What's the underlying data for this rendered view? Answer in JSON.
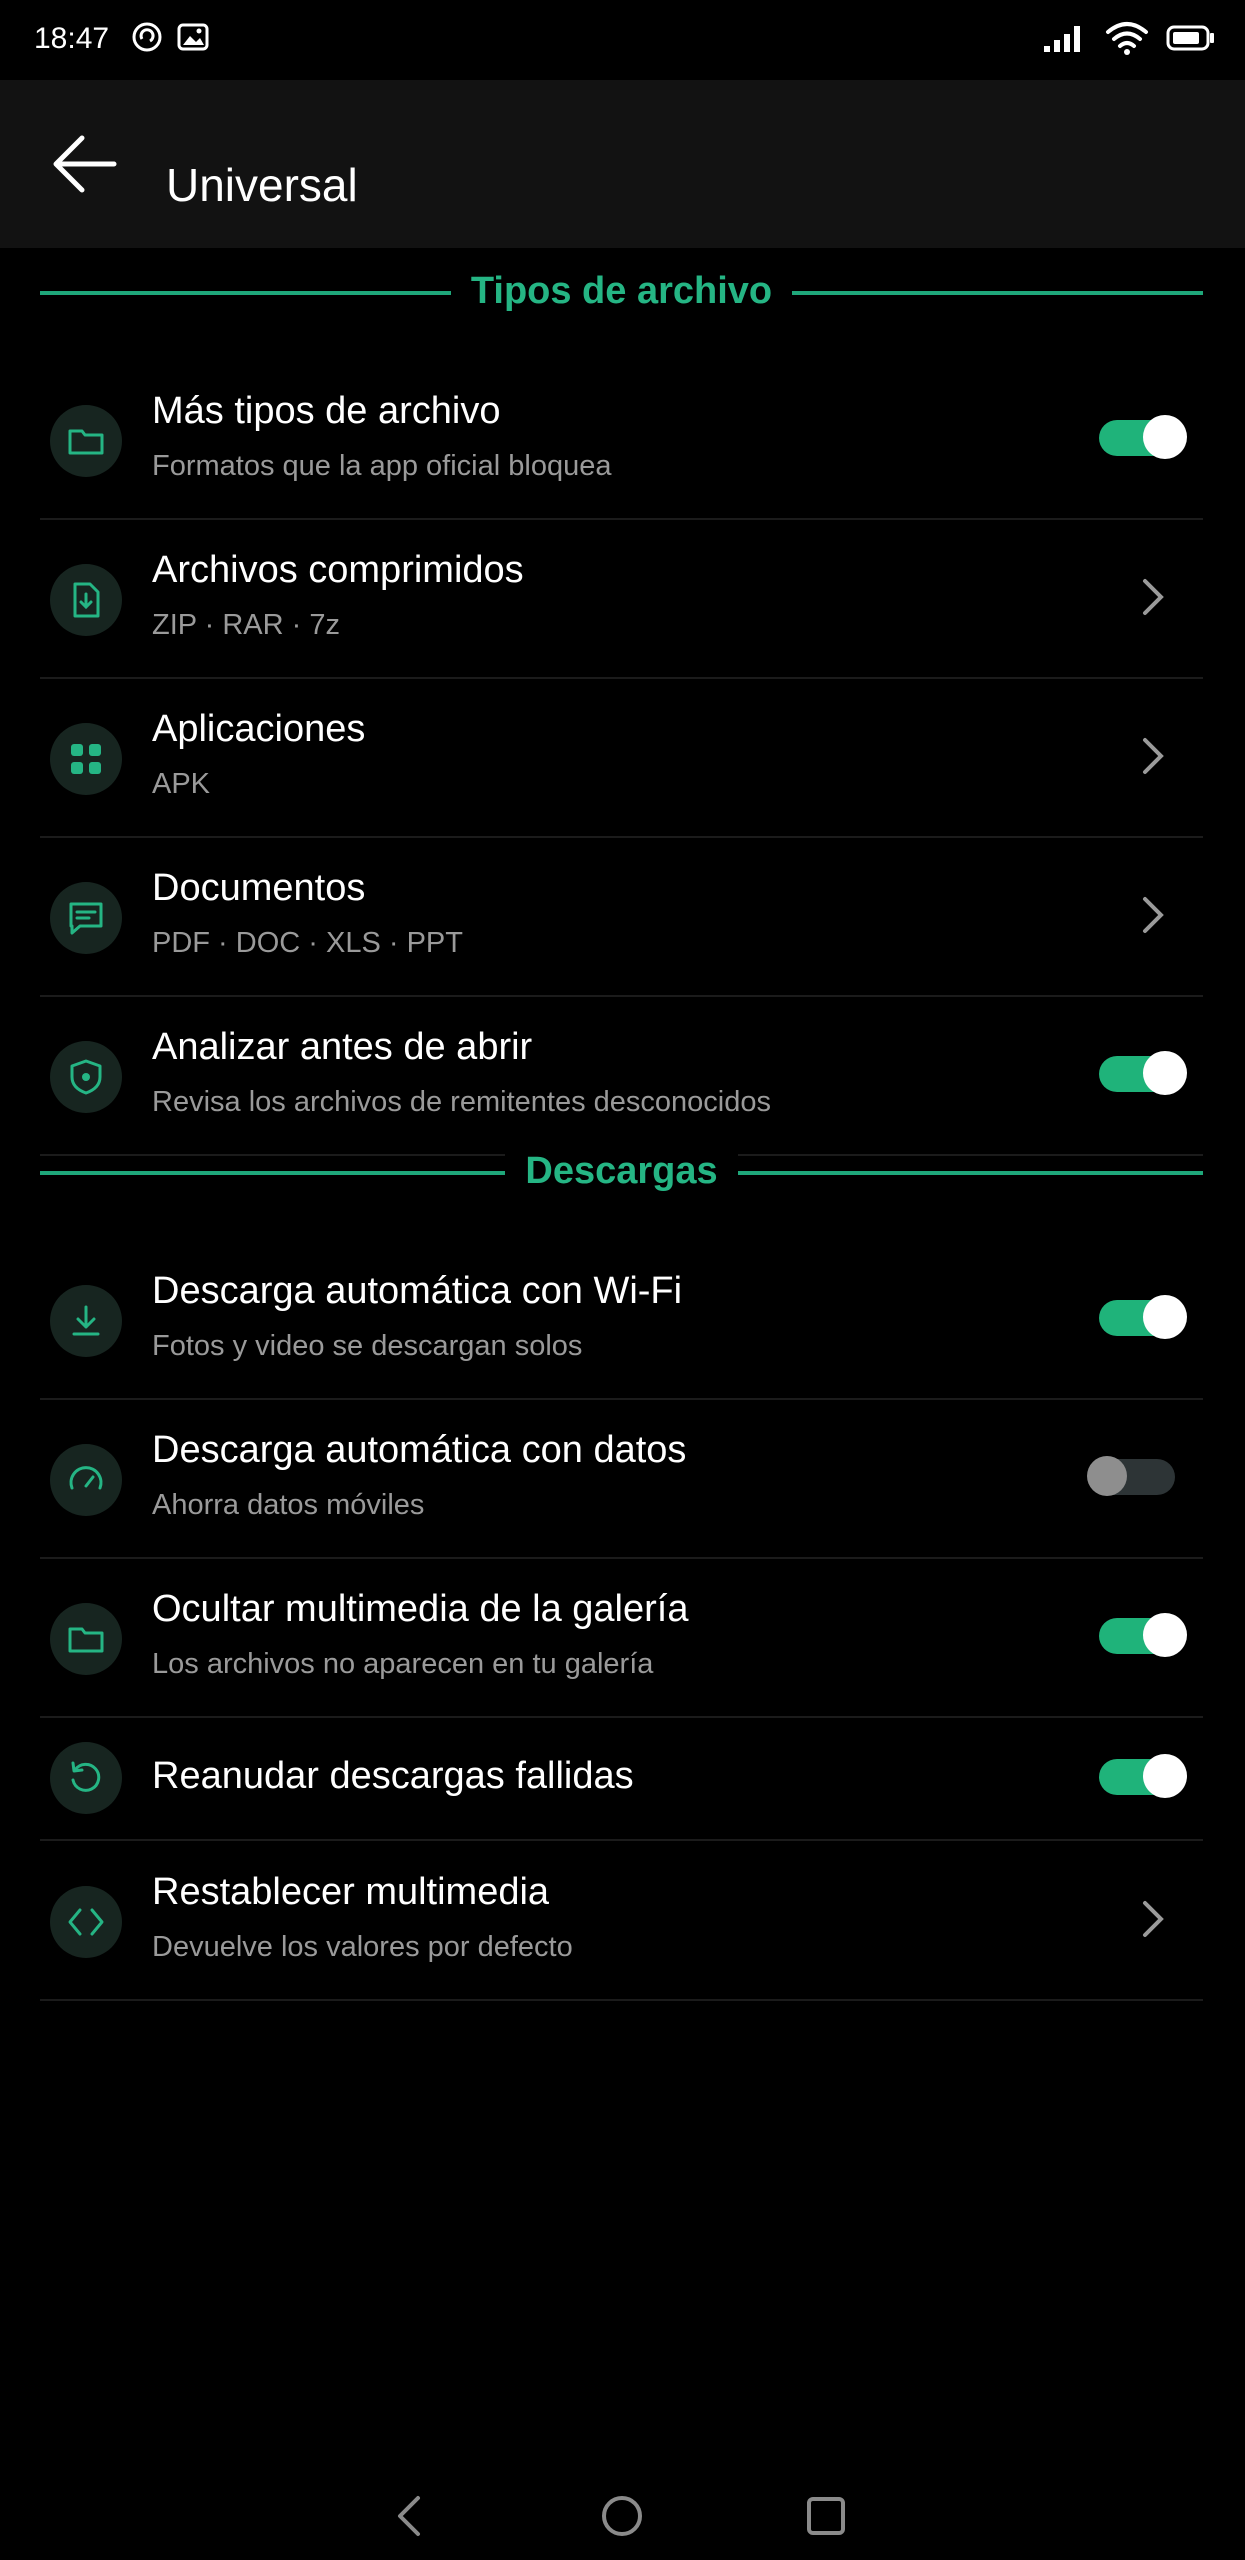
{
  "status_bar": {
    "time": "18:47",
    "left_icons": [
      "sync-icon",
      "image-icon"
    ],
    "right_icons": [
      "signal-icon",
      "wifi-icon",
      "battery-icon"
    ]
  },
  "app_bar": {
    "title": "Universal",
    "back_icon": "arrow-left-icon"
  },
  "colors": {
    "accent": "#25b584",
    "toggle_on": "#1fb37a",
    "toggle_off": "#2d3436",
    "background": "#000000",
    "appbar": "#121212",
    "icon_bg": "#172520",
    "subtitle": "#9a9a9a"
  },
  "sections": [
    {
      "title": "Tipos de archivo",
      "items": [
        {
          "icon": "folder-icon",
          "title": "Más tipos de archivo",
          "subtitle": "Formatos que la app oficial bloquea",
          "control": "toggle",
          "on": true
        },
        {
          "icon": "file-download-icon",
          "title": "Archivos comprimidos",
          "subtitle": "ZIP · RAR · 7z",
          "control": "chevron"
        },
        {
          "icon": "apps-icon",
          "title": "Aplicaciones",
          "subtitle": "APK",
          "control": "chevron"
        },
        {
          "icon": "message-icon",
          "title": "Documentos",
          "subtitle": "PDF · DOC · XLS · PPT",
          "control": "chevron"
        },
        {
          "icon": "shield-icon",
          "title": "Analizar antes de abrir",
          "subtitle": "Revisa los archivos de remitentes desconocidos",
          "control": "toggle",
          "on": true
        }
      ]
    },
    {
      "title": "Descargas",
      "items": [
        {
          "icon": "download-icon",
          "title": "Descarga automática con Wi-Fi",
          "subtitle": "Fotos y video se descargan solos",
          "control": "toggle",
          "on": true
        },
        {
          "icon": "gauge-icon",
          "title": "Descarga automática con datos",
          "subtitle": "Ahorra datos móviles",
          "control": "toggle",
          "on": false
        },
        {
          "icon": "folder-icon",
          "title": "Ocultar multimedia de la galería",
          "subtitle": "Los archivos no aparecen en tu galería",
          "control": "toggle",
          "on": true
        },
        {
          "icon": "retry-icon",
          "title": "Reanudar descargas fallidas",
          "control": "toggle",
          "on": true
        },
        {
          "icon": "code-icon",
          "title": "Restablecer multimedia",
          "subtitle": "Devuelve los valores por defecto",
          "control": "chevron"
        }
      ]
    }
  ],
  "nav_bar": {
    "buttons": [
      "back-triangle-icon",
      "home-circle-icon",
      "recents-square-icon"
    ]
  }
}
